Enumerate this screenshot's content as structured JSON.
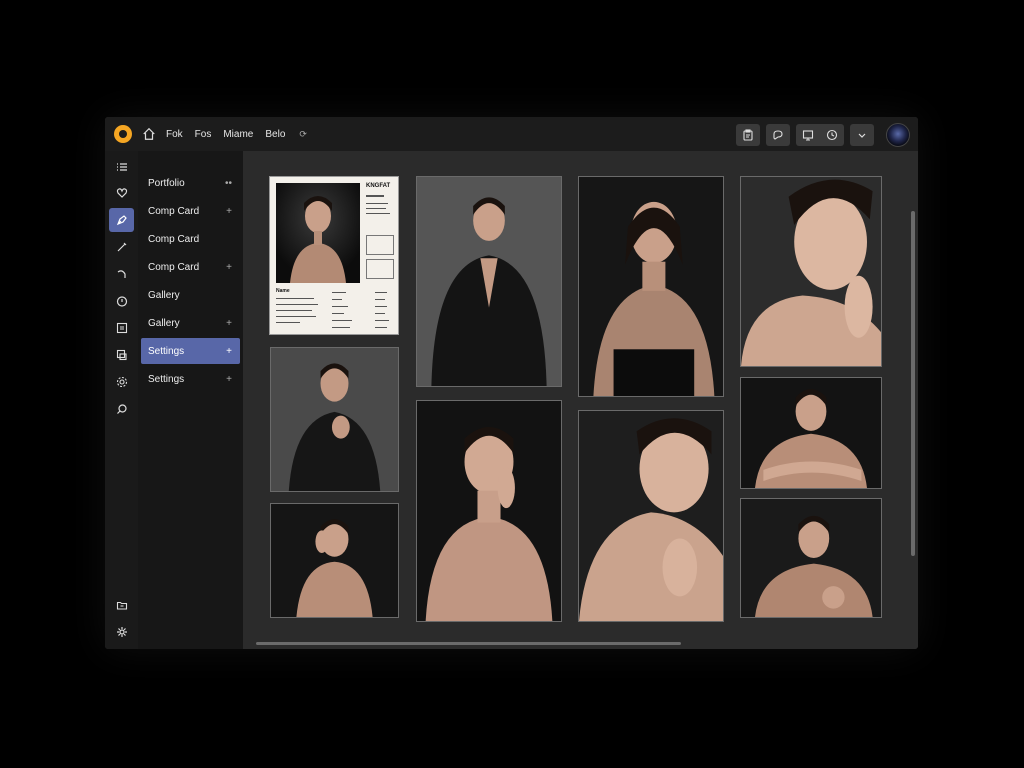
{
  "topbar": {
    "menu": [
      "Fok",
      "Fos",
      "Miame",
      "Belo"
    ],
    "icons": [
      "app-logo-icon",
      "home-icon",
      "refresh-icon",
      "clipboard-icon",
      "comment-icon",
      "screen-icon",
      "clock-icon",
      "chevron-down-icon",
      "user-avatar"
    ]
  },
  "rail": {
    "icons": [
      "list-icon",
      "heart-icon",
      "pen-nib-icon",
      "brush-icon",
      "curve-icon",
      "timer-icon",
      "image-grid-icon",
      "layers-icon",
      "settings-cog-icon",
      "search-icon",
      "folder-icon",
      "gear-icon"
    ],
    "active_index": 2
  },
  "nav": {
    "items": [
      {
        "label": "Portfolio",
        "mark": "••"
      },
      {
        "label": "Comp Card",
        "mark": "+"
      },
      {
        "label": "Comp Card",
        "mark": ""
      },
      {
        "label": "Comp Card",
        "mark": "+"
      },
      {
        "label": "Gallery",
        "mark": ""
      },
      {
        "label": "Gallery",
        "mark": "+"
      },
      {
        "label": "Settings",
        "mark": "+",
        "active": true
      },
      {
        "label": "Settings",
        "mark": "+"
      }
    ]
  },
  "comp_card": {
    "title": "KNGFAT",
    "name_label": "Name"
  },
  "colors": {
    "accent": "#5867a8",
    "logo": "#f5a623",
    "background": "#2b2b2b",
    "sidebar": "#171717"
  }
}
